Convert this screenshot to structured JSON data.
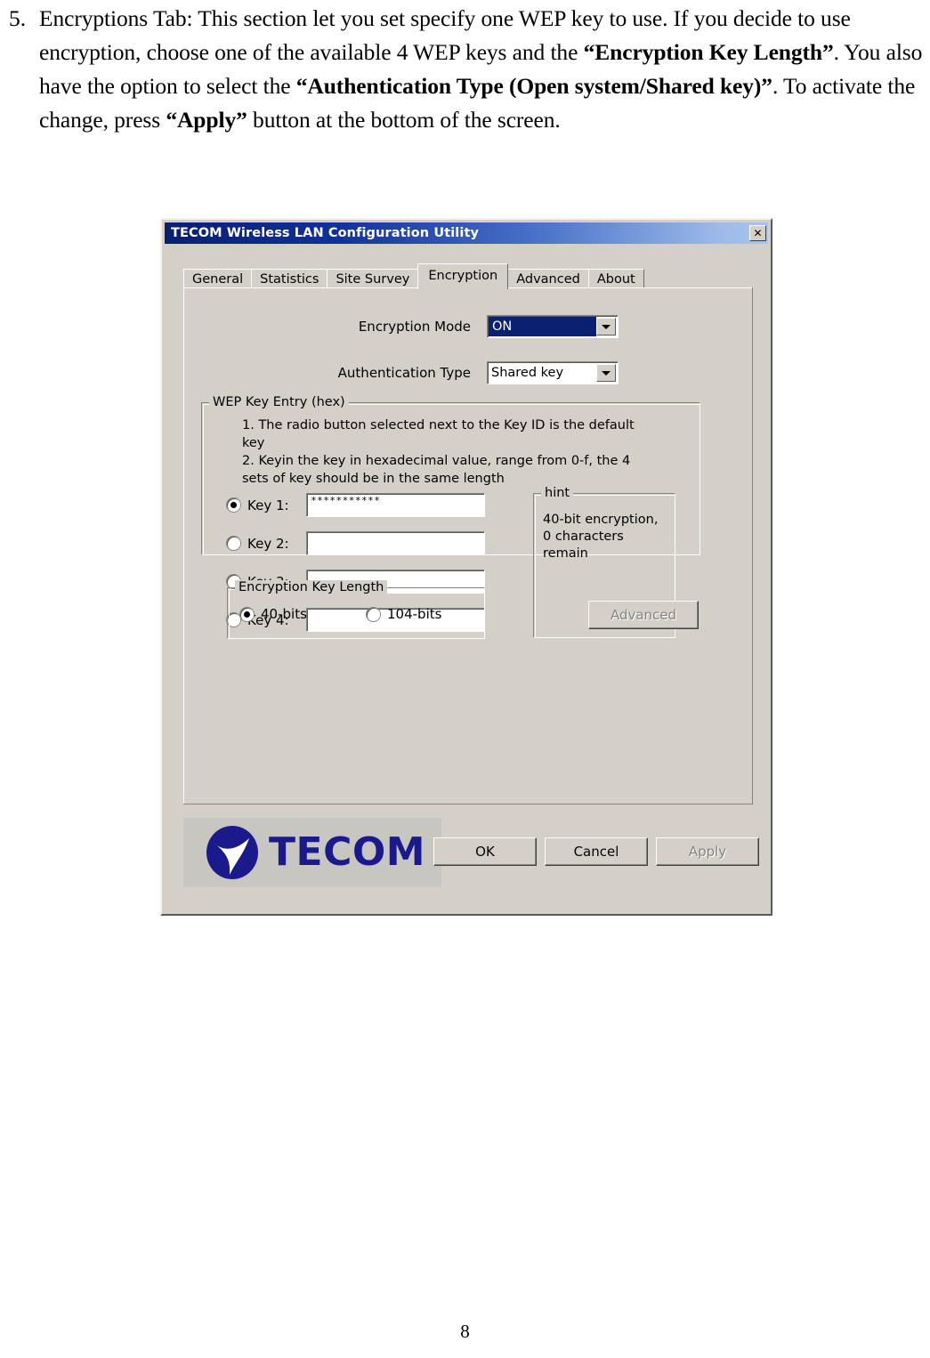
{
  "document": {
    "list_number": "5.",
    "paragraph_html": "Encryptions Tab: This section let you set specify one WEP key to use. If you decide to use encryption, choose one of the available 4 WEP keys and the <b>“Encryption Key Length”</b>. You also have the option to select the <b>“Authentication Type (Open system/Shared key)”</b>. To activate the change, press <b>“Apply”</b> button at the bottom of the screen.",
    "page_number": "8"
  },
  "dialog": {
    "title": "TECOM Wireless LAN Configuration Utility",
    "close_label": "✕",
    "tabs": [
      {
        "label": "General",
        "active": false
      },
      {
        "label": "Statistics",
        "active": false
      },
      {
        "label": "Site Survey",
        "active": false
      },
      {
        "label": "Encryption",
        "active": true
      },
      {
        "label": "Advanced",
        "active": false
      },
      {
        "label": "About",
        "active": false
      }
    ],
    "encryption_mode": {
      "label": "Encryption Mode",
      "value": "ON"
    },
    "authentication_type": {
      "label": "Authentication Type",
      "value": "Shared key"
    },
    "wep_group": {
      "title": "WEP Key Entry (hex)",
      "instruction_1": "1. The radio button selected next to the Key ID is the default key",
      "instruction_2": "2. Keyin the key in hexadecimal value, range from 0-f, the 4 sets of key should be in the same length",
      "keys": [
        {
          "label": "Key 1:",
          "value": "***********",
          "selected": true
        },
        {
          "label": "Key 2:",
          "value": "",
          "selected": false
        },
        {
          "label": "Key 3:",
          "value": "",
          "selected": false
        },
        {
          "label": "Key 4:",
          "value": "",
          "selected": false
        }
      ]
    },
    "hint_group": {
      "title": "hint",
      "text": "40-bit encryption, 0 characters remain"
    },
    "key_length_group": {
      "title": "Encryption Key Length",
      "options": [
        {
          "label": "40-bits",
          "selected": true
        },
        {
          "label": "104-bits",
          "selected": false
        }
      ]
    },
    "advanced_button": {
      "label": "Advanced",
      "enabled": false
    },
    "brand": {
      "name": "TECOM",
      "logo_color": "#1a1a8c"
    },
    "footer_buttons": [
      {
        "label": "OK",
        "enabled": true
      },
      {
        "label": "Cancel",
        "enabled": true
      },
      {
        "label": "Apply",
        "enabled": false
      }
    ]
  }
}
